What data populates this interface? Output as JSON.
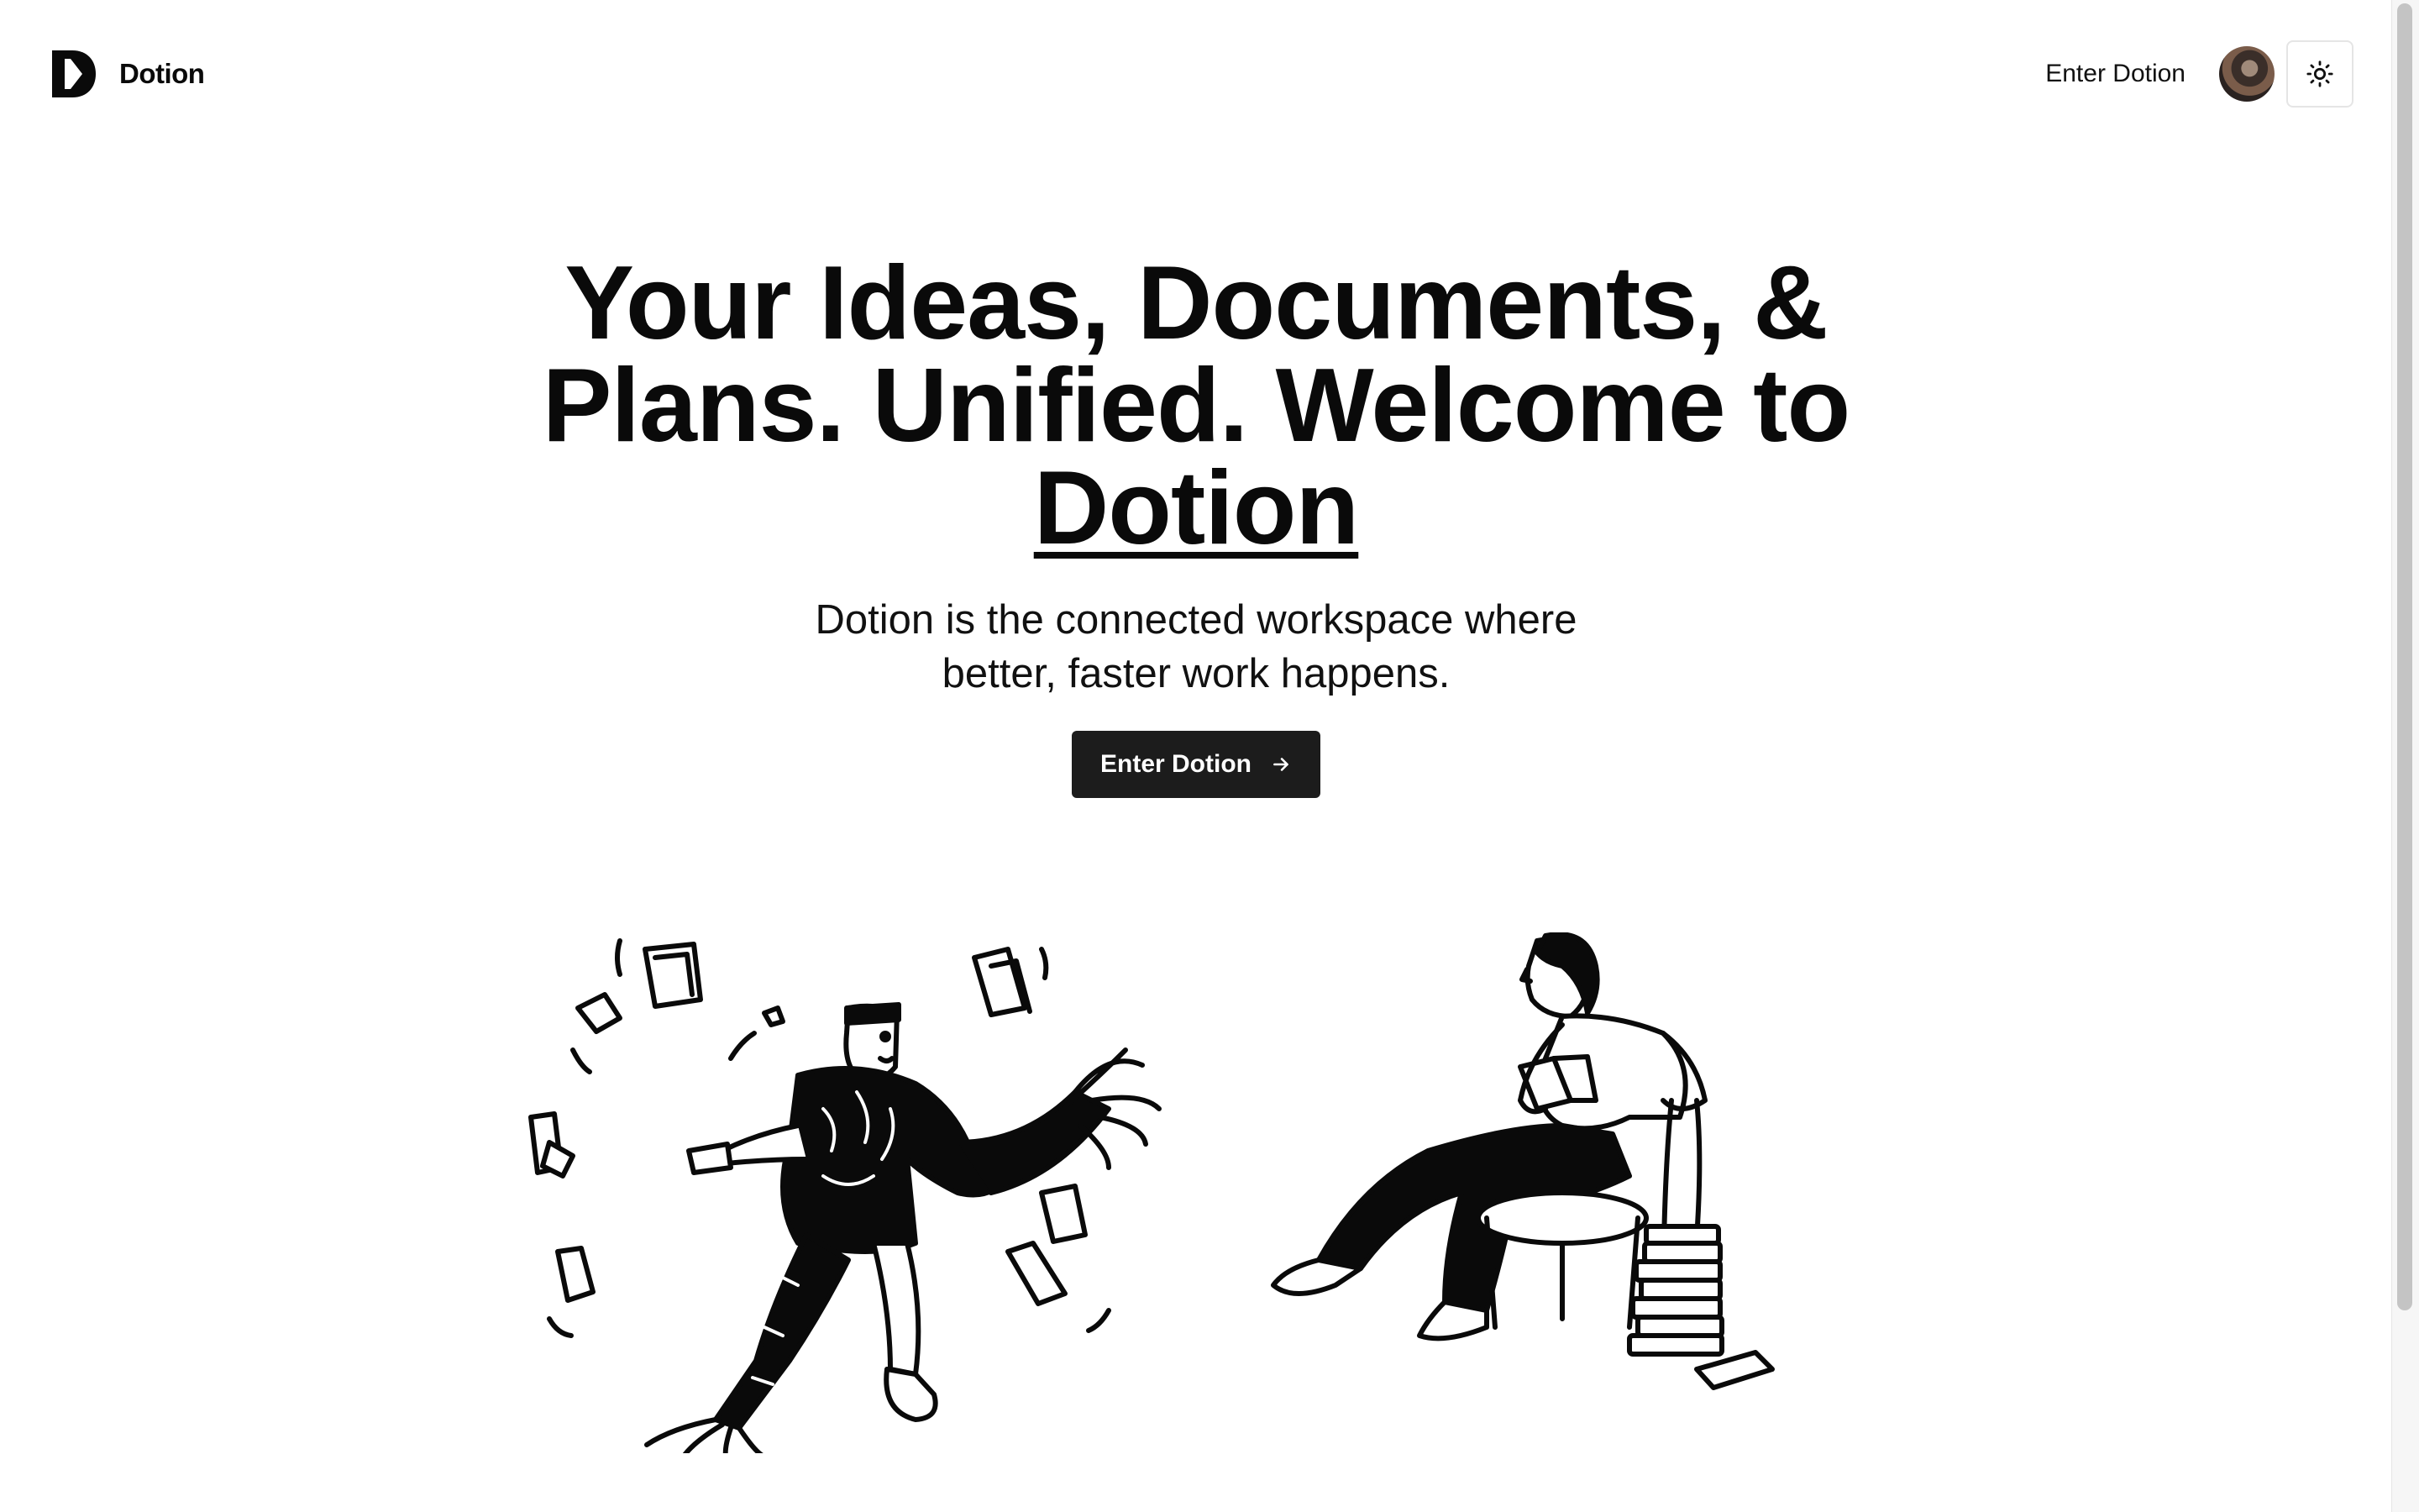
{
  "header": {
    "brand_name": "Dotion",
    "nav_link": "Enter Dotion",
    "theme_toggle_icon": "sun-icon"
  },
  "hero": {
    "headline_part1": "Your Ideas, Documents, & Plans. Unified. Welcome to ",
    "headline_brand": "Dotion",
    "subheadline": "Dotion is the connected workspace where better, faster work happens.",
    "cta_label": "Enter Dotion",
    "cta_icon": "arrow-right-icon"
  },
  "colors": {
    "background": "#ffffff",
    "text": "#0a0a0a",
    "button_bg": "#1c1c1c",
    "button_text": "#ffffff"
  }
}
